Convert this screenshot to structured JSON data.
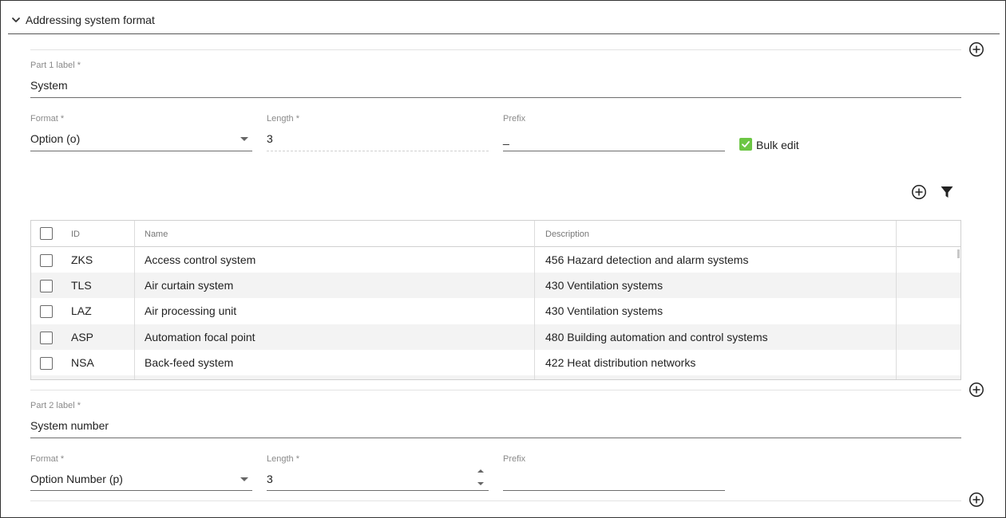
{
  "section": {
    "title": "Addressing system format"
  },
  "part1": {
    "label_title": "Part 1 label",
    "label_required": "*",
    "label_value": "System",
    "format": {
      "label": "Format",
      "required": "*",
      "value": "Option (o)"
    },
    "length": {
      "label": "Length",
      "required": "*",
      "value": "3"
    },
    "prefix": {
      "label": "Prefix",
      "value": "_"
    },
    "bulk_edit": {
      "label": "Bulk edit",
      "checked": true
    },
    "table": {
      "columns": [
        "ID",
        "Name",
        "Description"
      ],
      "rows": [
        {
          "id": "ZKS",
          "name": "Access control system",
          "description": "456 Hazard detection and alarm systems"
        },
        {
          "id": "TLS",
          "name": "Air curtain system",
          "description": "430 Ventilation systems"
        },
        {
          "id": "LAZ",
          "name": "Air processing unit",
          "description": "430 Ventilation systems"
        },
        {
          "id": "ASP",
          "name": "Automation focal point",
          "description": "480 Building automation and control systems"
        },
        {
          "id": "NSA",
          "name": "Back-feed system",
          "description": "422 Heat distribution networks"
        }
      ]
    }
  },
  "part2": {
    "label_title": "Part 2 label",
    "label_required": "*",
    "label_value": "System number",
    "format": {
      "label": "Format",
      "required": "*",
      "value": "Option Number (p)"
    },
    "length": {
      "label": "Length",
      "required": "*",
      "value": "3"
    },
    "prefix": {
      "label": "Prefix",
      "value": ""
    }
  },
  "colors": {
    "accent_green": "#6cc644",
    "border": "#333333",
    "row_alt": "#f3f3f3"
  },
  "icons": [
    "chevron-down-icon",
    "add-circle-icon",
    "filter-icon",
    "checkmark-icon",
    "dropdown-caret-icon",
    "stepper-up-icon",
    "stepper-down-icon"
  ]
}
